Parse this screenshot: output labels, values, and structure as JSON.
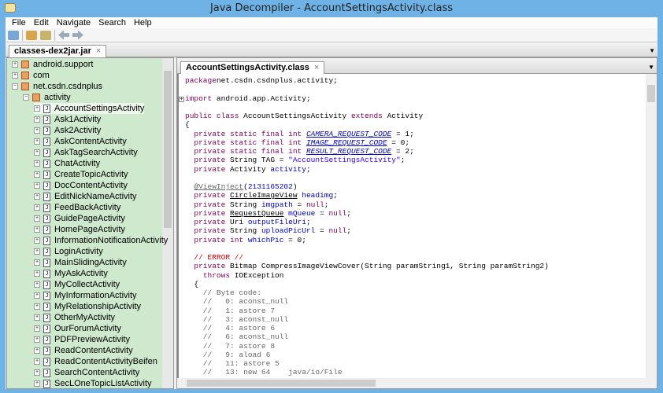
{
  "window": {
    "title": "Java Decompiler - AccountSettingsActivity.class"
  },
  "menu": [
    "File",
    "Edit",
    "Navigate",
    "Search",
    "Help"
  ],
  "toolbar": [
    "open-icon",
    "open-type-icon",
    "search-icon",
    "back-icon",
    "forward-icon"
  ],
  "file_tab": {
    "label": "classes-dex2jar.jar",
    "close": "×"
  },
  "tree": {
    "packages": [
      {
        "label": "android.support",
        "level": 0,
        "sign": "+"
      },
      {
        "label": "com",
        "level": 0,
        "sign": "+"
      },
      {
        "label": "net.csdn.csdnplus",
        "level": 0,
        "sign": "-"
      },
      {
        "label": "activity",
        "level": 1,
        "sign": "-"
      }
    ],
    "classes": [
      "AccountSettingsActivity",
      "Ask1Activity",
      "Ask2Activity",
      "AskContentActivity",
      "AskTagSearchActivity",
      "ChatActivity",
      "CreateTopicActivity",
      "DocContentActivity",
      "EditNickNameActivity",
      "FeedBackActivity",
      "GuidePageActivity",
      "HomePageActivity",
      "InformationNotificationActivity",
      "LoginActivity",
      "MainSlidingActivity",
      "MyAskActivity",
      "MyCollectActivity",
      "MyInformationActivity",
      "MyRelationshipActivity",
      "OtherMyActivity",
      "OurForumActivity",
      "PDFPreviewActivity",
      "ReadContentActivity",
      "ReadContentActivityBeifen",
      "SearchContentActivity",
      "SecLOneTopicListActivity"
    ],
    "selected": "AccountSettingsActivity"
  },
  "code_tab": {
    "label": "AccountSettingsActivity.class",
    "close": "×"
  },
  "code": [
    [
      [
        "kw",
        "package"
      ],
      [
        "",
        "net.csdn.csdnplus.activity;"
      ]
    ],
    [],
    [
      [
        "kw",
        "import"
      ],
      [
        "",
        " android.app.Activity;"
      ]
    ],
    [],
    [
      [
        "kw",
        "public class"
      ],
      [
        "",
        " AccountSettingsActivity "
      ],
      [
        "kw",
        "extends"
      ],
      [
        "",
        " Activity"
      ]
    ],
    [
      [
        "",
        "{"
      ]
    ],
    [
      [
        "",
        "  "
      ],
      [
        "kw",
        "private static final int"
      ],
      [
        "",
        " "
      ],
      [
        "cst",
        "CAMERA_REQUEST_CODE"
      ],
      [
        "",
        " = 1;"
      ]
    ],
    [
      [
        "",
        "  "
      ],
      [
        "kw",
        "private static final int"
      ],
      [
        "",
        " "
      ],
      [
        "cst",
        "IMAGE_REQUEST_CODE"
      ],
      [
        "",
        " = 0;"
      ]
    ],
    [
      [
        "",
        "  "
      ],
      [
        "kw",
        "private static final int"
      ],
      [
        "",
        " "
      ],
      [
        "cst",
        "RESULT_REQUEST_CODE"
      ],
      [
        "",
        " = 2;"
      ]
    ],
    [
      [
        "",
        "  "
      ],
      [
        "kw",
        "private"
      ],
      [
        "",
        " String TAG = "
      ],
      [
        "str",
        "\"AccountSettingsActivity\""
      ],
      [
        "",
        ";"
      ]
    ],
    [
      [
        "",
        "  "
      ],
      [
        "kw",
        "private"
      ],
      [
        "",
        " Activity "
      ],
      [
        "fld",
        "activity"
      ],
      [
        "",
        ";"
      ]
    ],
    [],
    [
      [
        "",
        "  "
      ],
      [
        "ann",
        "@ViewInject"
      ],
      [
        "",
        "("
      ],
      [
        "num",
        "2131165202"
      ],
      [
        "",
        ")"
      ]
    ],
    [
      [
        "",
        "  "
      ],
      [
        "kw",
        "private"
      ],
      [
        "",
        " "
      ],
      [
        "typ",
        "CircleImageView"
      ],
      [
        "",
        " "
      ],
      [
        "fld",
        "headimg"
      ],
      [
        "",
        ";"
      ]
    ],
    [
      [
        "",
        "  "
      ],
      [
        "kw",
        "private"
      ],
      [
        "",
        " String "
      ],
      [
        "fld",
        "imgpath"
      ],
      [
        "",
        " = "
      ],
      [
        "kw",
        "null"
      ],
      [
        "",
        ";"
      ]
    ],
    [
      [
        "",
        "  "
      ],
      [
        "kw",
        "private"
      ],
      [
        "",
        " "
      ],
      [
        "typ",
        "RequestQueue"
      ],
      [
        "",
        " "
      ],
      [
        "fld",
        "mQueue"
      ],
      [
        "",
        " = "
      ],
      [
        "kw",
        "null"
      ],
      [
        "",
        ";"
      ]
    ],
    [
      [
        "",
        "  "
      ],
      [
        "kw",
        "private"
      ],
      [
        "",
        " Uri "
      ],
      [
        "fld",
        "outputFileUri"
      ],
      [
        "",
        ";"
      ]
    ],
    [
      [
        "",
        "  "
      ],
      [
        "kw",
        "private"
      ],
      [
        "",
        " String "
      ],
      [
        "fld",
        "uploadPicUrl"
      ],
      [
        "",
        " = "
      ],
      [
        "kw",
        "null"
      ],
      [
        "",
        ";"
      ]
    ],
    [
      [
        "",
        "  "
      ],
      [
        "kw",
        "private int"
      ],
      [
        "",
        " "
      ],
      [
        "fld",
        "whichPic"
      ],
      [
        "",
        " = 0;"
      ]
    ],
    [],
    [
      [
        "",
        "  "
      ],
      [
        "err",
        "// ERROR //"
      ]
    ],
    [
      [
        "",
        "  "
      ],
      [
        "kw",
        "private"
      ],
      [
        "",
        " Bitmap CompressImageViewCover(String paramString1, String paramString2)"
      ]
    ],
    [
      [
        "",
        "    "
      ],
      [
        "kw",
        "throws"
      ],
      [
        "",
        " IOException"
      ]
    ],
    [
      [
        "",
        "  {"
      ]
    ],
    [
      [
        "cmt",
        "    // Byte code:"
      ]
    ],
    [
      [
        "cmt",
        "    //   0: aconst_null"
      ]
    ],
    [
      [
        "cmt",
        "    //   1: astore 7"
      ]
    ],
    [
      [
        "cmt",
        "    //   3: aconst_null"
      ]
    ],
    [
      [
        "cmt",
        "    //   4: astore 6"
      ]
    ],
    [
      [
        "cmt",
        "    //   6: aconst_null"
      ]
    ],
    [
      [
        "cmt",
        "    //   7: astore 8"
      ]
    ],
    [
      [
        "cmt",
        "    //   9: aload 6"
      ]
    ],
    [
      [
        "cmt",
        "    //   11: astore 5"
      ]
    ],
    [
      [
        "cmt",
        "    //   13: new 64    java/io/File"
      ]
    ]
  ]
}
